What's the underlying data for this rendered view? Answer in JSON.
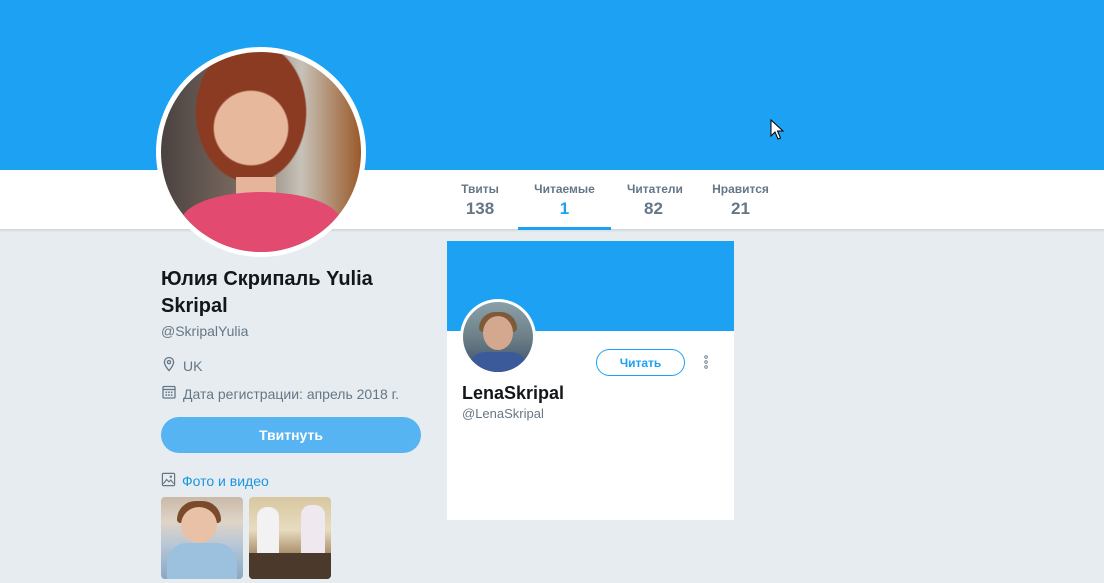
{
  "stats": [
    {
      "label": "Твиты",
      "value": "138"
    },
    {
      "label": "Читаемые",
      "value": "1"
    },
    {
      "label": "Читатели",
      "value": "82"
    },
    {
      "label": "Нравится",
      "value": "21"
    }
  ],
  "profile": {
    "name": "Юлия Скрипаль Yulia Skripal",
    "handle": "@SkripalYulia",
    "location": "UK",
    "joined": "Дата регистрации: апрель 2018 г.",
    "tweet_button": "Твитнуть",
    "media_link": "Фото и видео"
  },
  "following_card": {
    "name": "LenaSkripal",
    "handle": "@LenaSkripal",
    "follow_button": "Читать"
  },
  "colors": {
    "brand": "#1da1f2",
    "background": "#e6ecf0",
    "muted_text": "#657786"
  },
  "icons": {
    "location": "location-pin-icon",
    "calendar": "calendar-icon",
    "media": "image-icon",
    "more": "more-vertical-icon",
    "cursor": "mouse-cursor-icon"
  }
}
